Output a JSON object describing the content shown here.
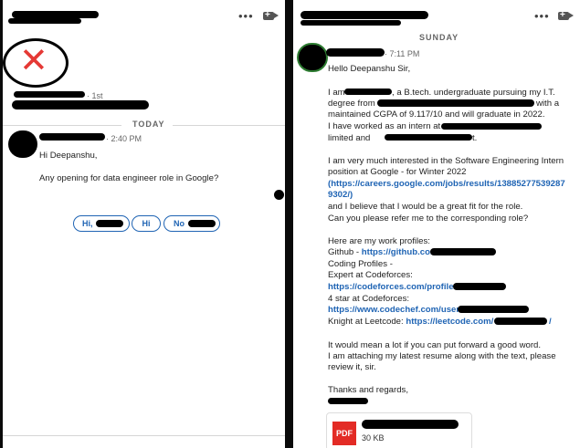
{
  "left": {
    "connection_degree": "· 1st",
    "day_divider": "TODAY",
    "message_time": "· 2:40 PM",
    "greeting": "Hi Deepanshu,",
    "question": "Any opening for data engineer role in Google?",
    "smart_replies": [
      "Hi,",
      "Hi",
      "No"
    ]
  },
  "right": {
    "day_divider": "SUNDAY",
    "message_time": "· 7:11 PM",
    "lines": {
      "salutation": "Hello Deepanshu Sir,",
      "p1_a": "I am",
      "p1_b": ", a B.tech. undergraduate pursuing my I.T.",
      "p1_c": "degree from",
      "p1_d": "with a",
      "p1_e": "maintained CGPA of 9.117/10 and will graduate in 2022.",
      "p1_f": "I have worked as an intern at",
      "p1_g": "limited and",
      "p1_h": "t.",
      "p2_a": "I am very much interested in the Software Engineering Intern",
      "p2_b": "position at Google - for Winter 2022",
      "p2_link_a": "(https://careers.google.com/jobs/results/13885277539287",
      "p2_link_b": "9302/)",
      "p2_c": "and I believe that I would be a great fit for the role.",
      "p2_d": "Can you please refer me to the corresponding role?",
      "p3_a": "Here are my work profiles:",
      "p3_github_label": "Github - ",
      "p3_github_link": "https://github.com/",
      "p3_coding": "Coding Profiles -",
      "p3_expert": "Expert at Codeforces:",
      "p3_cf_link": "https://codeforces.com/profile/",
      "p3_codechef": "4 star at Codeforces:",
      "p3_cc_link": "https://www.codechef.com/users/",
      "p3_knight_label": "Knight at Leetcode: ",
      "p3_lc_link": "https://leetcode.com/",
      "p3_lc_tail": "/",
      "p4_a": "It would mean a lot if you can put forward a good word.",
      "p4_b": "I am attaching my latest resume along with the text, please",
      "p4_c": "review it, sir.",
      "closing": "Thanks and regards,"
    },
    "attachment_badge": "PDF",
    "attachment_size": "30 KB"
  },
  "colors": {
    "link": "#1f64b4",
    "pdf_red": "#e32b25",
    "x_red": "#e53935"
  }
}
